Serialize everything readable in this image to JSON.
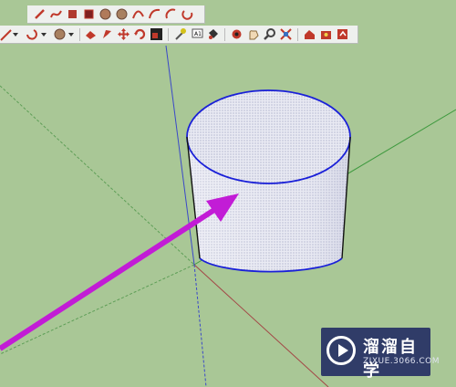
{
  "toolbar_row1": {
    "tools": [
      "pencil-icon",
      "freehand-icon",
      "rectangle-icon",
      "rotated-rectangle-icon",
      "circle-icon",
      "polygon-icon",
      "arc-icon",
      "two-point-arc-icon",
      "pie-icon",
      "three-point-arc-icon"
    ]
  },
  "toolbar_row2": {
    "tools": [
      "line-tool-icon",
      "dropdown-icon",
      "arc-tool-icon",
      "dropdown-icon",
      "circle-tool-icon",
      "dropdown-icon",
      "push-pull-icon",
      "follow-me-icon",
      "move-icon",
      "rotate-icon",
      "scale-icon",
      "tape-measure-icon",
      "text-icon",
      "paint-bucket-icon",
      "orbit-icon",
      "pan-icon",
      "zoom-icon",
      "zoom-extents-icon",
      "warehouse-icon",
      "extension-icon",
      "share-model-icon"
    ]
  },
  "colors": {
    "viewport_background": "#a9c796",
    "cylinder_edge": "#1a20d8",
    "cylinder_fill": "#e6e7f1",
    "arrow": "#c21cd6",
    "axis_red": "#a34646",
    "axis_green": "#5aa85a",
    "axis_blue": "#3a48c8"
  },
  "watermark": {
    "brand": "溜溜自学",
    "url": "ZIXUE.3066.COM"
  }
}
